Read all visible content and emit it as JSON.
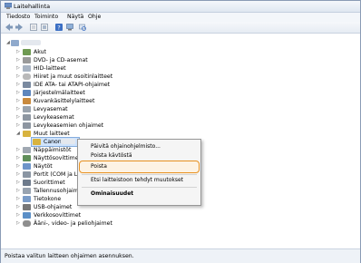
{
  "window": {
    "title": "Laitehallinta"
  },
  "menu": [
    "Tiedosto",
    "Toiminto",
    "Näytä",
    "Ohje"
  ],
  "toolbar": [
    "back-icon",
    "forward-icon",
    "properties-icon",
    "list-icon",
    "help-icon",
    "computer-icon",
    "scan-icon"
  ],
  "tree": {
    "root_label": "",
    "items": [
      "Akut",
      "DVD- ja CD-asemat",
      "HID-laitteet",
      "Hiiret ja muut osoitinlaitteet",
      "IDE ATA- tai ATAPI-ohjaimet",
      "Järjestelmälaitteet",
      "Kuvankäsittelylaitteet",
      "Levyasemat",
      "Levykeasemat",
      "Levykeasemien ohjaimet",
      "Muut laitteet"
    ],
    "child": "Canon",
    "items_after": [
      "Näppäimistöt",
      "Näyttösovittimet",
      "Näytöt",
      "Portit (COM ja LP",
      "Suorittimet",
      "Tallennusohjaimet",
      "Tietokone",
      "USB-ohjaimet",
      "Verkkosovittimet",
      "Ääni-, video- ja peliohjaimet"
    ]
  },
  "context_menu": {
    "update": "Päivitä ohjainohjelmisto...",
    "disable": "Poista käytöstä",
    "uninstall": "Poista",
    "scan": "Etsi laitteistoon tehdyt muutokset",
    "properties": "Ominaisuudet"
  },
  "status": "Poistaa valitun laitteen ohjaimen asennuksen.",
  "colors": {
    "highlight": "#e8911f",
    "selection": "#cfe3fc"
  }
}
